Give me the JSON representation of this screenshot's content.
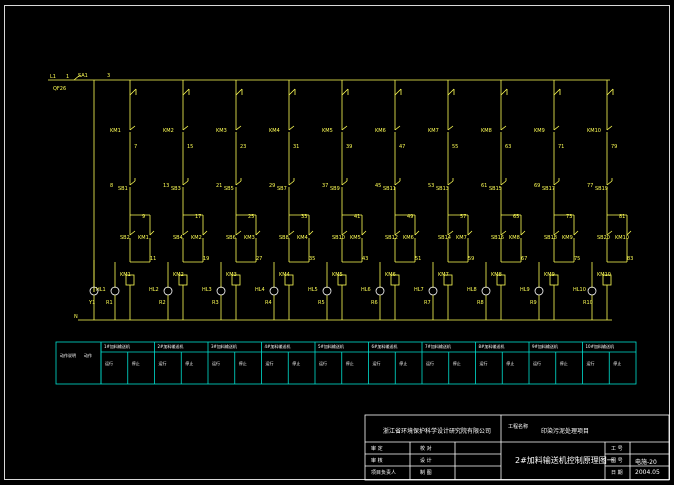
{
  "colors": {
    "background": "#000000",
    "wire": "#ffff55",
    "table_lines": "#00e0d0",
    "table_text": "#00ff66",
    "lamp": "#ffffff",
    "titleblock": "#ffffff"
  },
  "power": {
    "l1": "L1",
    "one": "1",
    "switch": "SA1",
    "breaker": "QF26",
    "node3": "3",
    "neutral": "N"
  },
  "units": [
    {
      "km": "KM1",
      "n1": "",
      "n2": "7",
      "n3": "8",
      "sbA": "SB1",
      "n4": "9",
      "sbB": "SB2",
      "k2": "KM1",
      "n5": "11",
      "n6": "",
      "coil": "KM1",
      "hl": "HL1",
      "cap": "Y1",
      "r": "R1"
    },
    {
      "km": "KM2",
      "n1": "",
      "n2": "15",
      "n3": "13",
      "sbA": "SB3",
      "n4": "17",
      "sbB": "SB4",
      "k2": "KM2",
      "n5": "19",
      "n6": "",
      "coil": "KM2",
      "hl": "HL2",
      "cap": "",
      "r": "R2"
    },
    {
      "km": "KM3",
      "n1": "",
      "n2": "23",
      "n3": "21",
      "sbA": "SB5",
      "n4": "25",
      "sbB": "SB6",
      "k2": "KM3",
      "n5": "27",
      "n6": "",
      "coil": "KM3",
      "hl": "HL3",
      "cap": "",
      "r": "R3"
    },
    {
      "km": "KM4",
      "n1": "",
      "n2": "31",
      "n3": "29",
      "sbA": "SB7",
      "n4": "33",
      "sbB": "SB8",
      "k2": "KM4",
      "n5": "35",
      "n6": "",
      "coil": "KM4",
      "hl": "HL4",
      "cap": "",
      "r": "R4"
    },
    {
      "km": "KM5",
      "n1": "",
      "n2": "39",
      "n3": "37",
      "sbA": "SB9",
      "n4": "41",
      "sbB": "SB10",
      "k2": "KM5",
      "n5": "43",
      "n6": "",
      "coil": "KM5",
      "hl": "HL5",
      "cap": "",
      "r": "R5"
    },
    {
      "km": "KM6",
      "n1": "",
      "n2": "47",
      "n3": "45",
      "sbA": "SB11",
      "n4": "49",
      "sbB": "SB12",
      "k2": "KM6",
      "n5": "51",
      "n6": "",
      "coil": "KM6",
      "hl": "HL6",
      "cap": "",
      "r": "R6"
    },
    {
      "km": "KM7",
      "n1": "",
      "n2": "55",
      "n3": "53",
      "sbA": "SB13",
      "n4": "57",
      "sbB": "SB14",
      "k2": "KM7",
      "n5": "59",
      "n6": "",
      "coil": "KM7",
      "hl": "HL7",
      "cap": "",
      "r": "R7"
    },
    {
      "km": "KM8",
      "n1": "",
      "n2": "63",
      "n3": "61",
      "sbA": "SB15",
      "n4": "65",
      "sbB": "SB16",
      "k2": "KM8",
      "n5": "67",
      "n6": "",
      "coil": "KM8",
      "hl": "HL8",
      "cap": "",
      "r": "R8"
    },
    {
      "km": "KM9",
      "n1": "",
      "n2": "71",
      "n3": "69",
      "sbA": "SB17",
      "n4": "73",
      "sbB": "SB18",
      "k2": "KM9",
      "n5": "75",
      "n6": "",
      "coil": "KM9",
      "hl": "HL9",
      "cap": "",
      "r": "R9"
    },
    {
      "km": "KM10",
      "n1": "",
      "n2": "79",
      "n3": "77",
      "sbA": "SB19",
      "n4": "81",
      "sbB": "SB20",
      "k2": "KM10",
      "n5": "83",
      "n6": "",
      "coil": "KM10",
      "hl": "HL10",
      "cap": "",
      "r": "R10"
    }
  ],
  "function_table": {
    "left_cells": [
      "动作说明",
      "动作"
    ],
    "groups": [
      {
        "header": "1#加料输送机",
        "cells": [
          "运行",
          "停止"
        ]
      },
      {
        "header": "2#加料输送机",
        "cells": [
          "运行",
          "停止"
        ]
      },
      {
        "header": "3#加料输送机",
        "cells": [
          "运行",
          "停止"
        ]
      },
      {
        "header": "4#加料输送机",
        "cells": [
          "运行",
          "停止"
        ]
      },
      {
        "header": "5#加料输送机",
        "cells": [
          "运行",
          "停止"
        ]
      },
      {
        "header": "6#加料输送机",
        "cells": [
          "运行",
          "停止"
        ]
      },
      {
        "header": "7#加料输送机",
        "cells": [
          "运行",
          "停止"
        ]
      },
      {
        "header": "8#加料输送机",
        "cells": [
          "运行",
          "停止"
        ]
      },
      {
        "header": "9#加料输送机",
        "cells": [
          "运行",
          "停止"
        ]
      },
      {
        "header": "10#加料输送机",
        "cells": [
          "运行",
          "停止"
        ]
      }
    ]
  },
  "title_block": {
    "company": "浙江省环境保护科学设计研究院有限公司",
    "project_label": "工程名称",
    "project_name": "印染污泥处理项目",
    "drawing_title": "2#加料输送机控制原理图一",
    "rows": [
      {
        "a": "审 定",
        "b": "校 对"
      },
      {
        "a": "审 核",
        "b": "设 计"
      },
      {
        "a": "项目负责人",
        "b": "制 图"
      }
    ],
    "right_labels": [
      "工 号",
      "图 号",
      "日 期"
    ],
    "drawing_no": "电施-20",
    "date": "2004.05"
  }
}
